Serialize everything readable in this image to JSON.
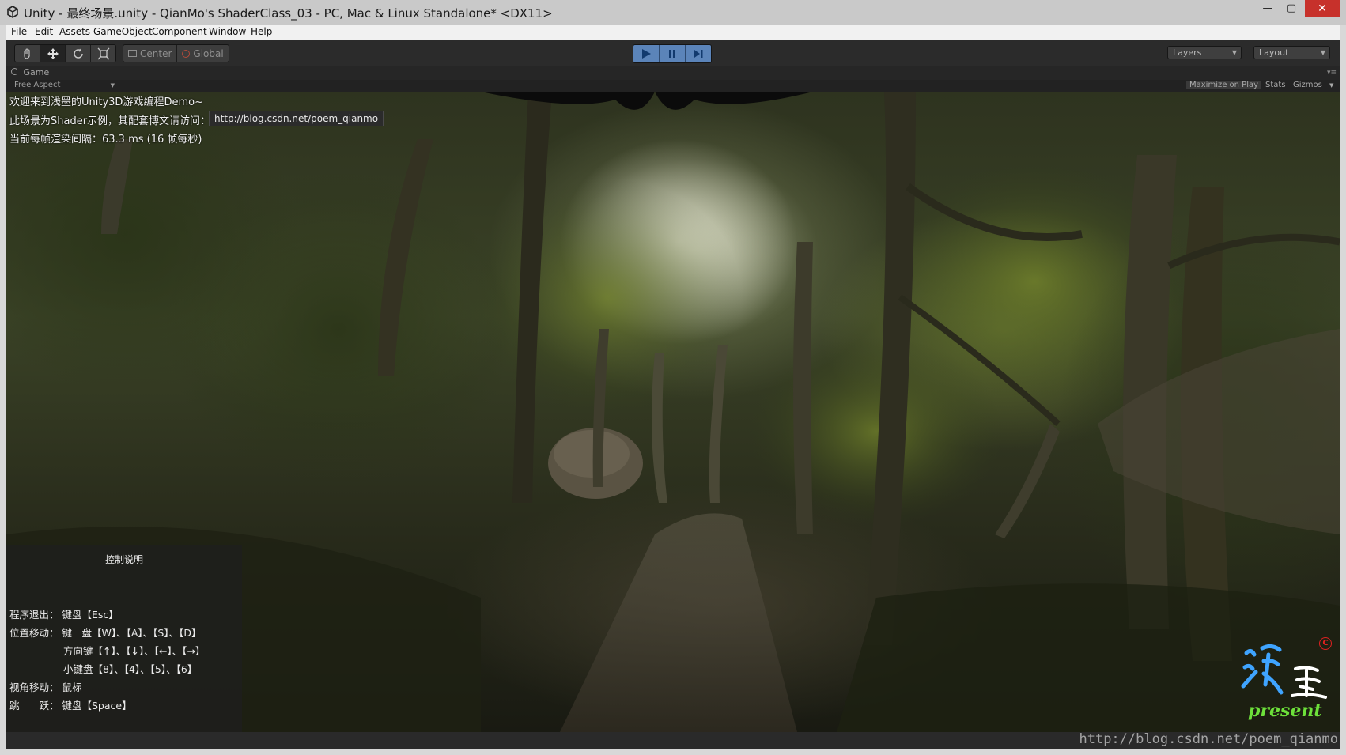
{
  "window": {
    "title": "Unity - 最终场景.unity - QianMo's ShaderClass_03 - PC, Mac & Linux Standalone* <DX11>",
    "minimize": "—",
    "maximize": "▢",
    "close": "✕"
  },
  "menu": [
    "File",
    "Edit",
    "Assets",
    "GameObject",
    "Component",
    "Window",
    "Help"
  ],
  "toolbar": {
    "pivot_center": "Center",
    "pivot_global": "Global",
    "layers": "Layers",
    "layout": "Layout"
  },
  "game_panel": {
    "tab": "Game",
    "aspect": "Free Aspect",
    "maximize_on_play": "Maximize on Play",
    "stats": "Stats",
    "gizmos": "Gizmos"
  },
  "overlay": {
    "welcome": "欢迎来到浅墨的Unity3D游戏编程Demo~",
    "shader_note": "此场景为Shader示例，其配套博文请访问：",
    "blog_url": "http://blog.csdn.net/poem_qianmo",
    "frame_time": "当前每帧渲染间隔：63.3 ms (16 帧每秒)"
  },
  "controls": {
    "title": "控制说明",
    "lines": [
      "程序退出：  键盘【Esc】",
      "位置移动：  键　盘【W】、【A】、【S】、【D】",
      "方向键【↑】、【↓】、【←】、【→】",
      "小键盘【8】、【4】、【5】、【6】",
      "视角移动：  鼠标",
      "跳　　跃：  键盘【Space】"
    ]
  },
  "logo": {
    "text": "present",
    "copyright": "C"
  },
  "watermark": "http://blog.csdn.net/poem_qianmo",
  "colors": {
    "play_accent": "#5b84b9",
    "close_button": "#c7312b",
    "logo_green": "#6de03a",
    "logo_blue": "#3fa4ff"
  }
}
